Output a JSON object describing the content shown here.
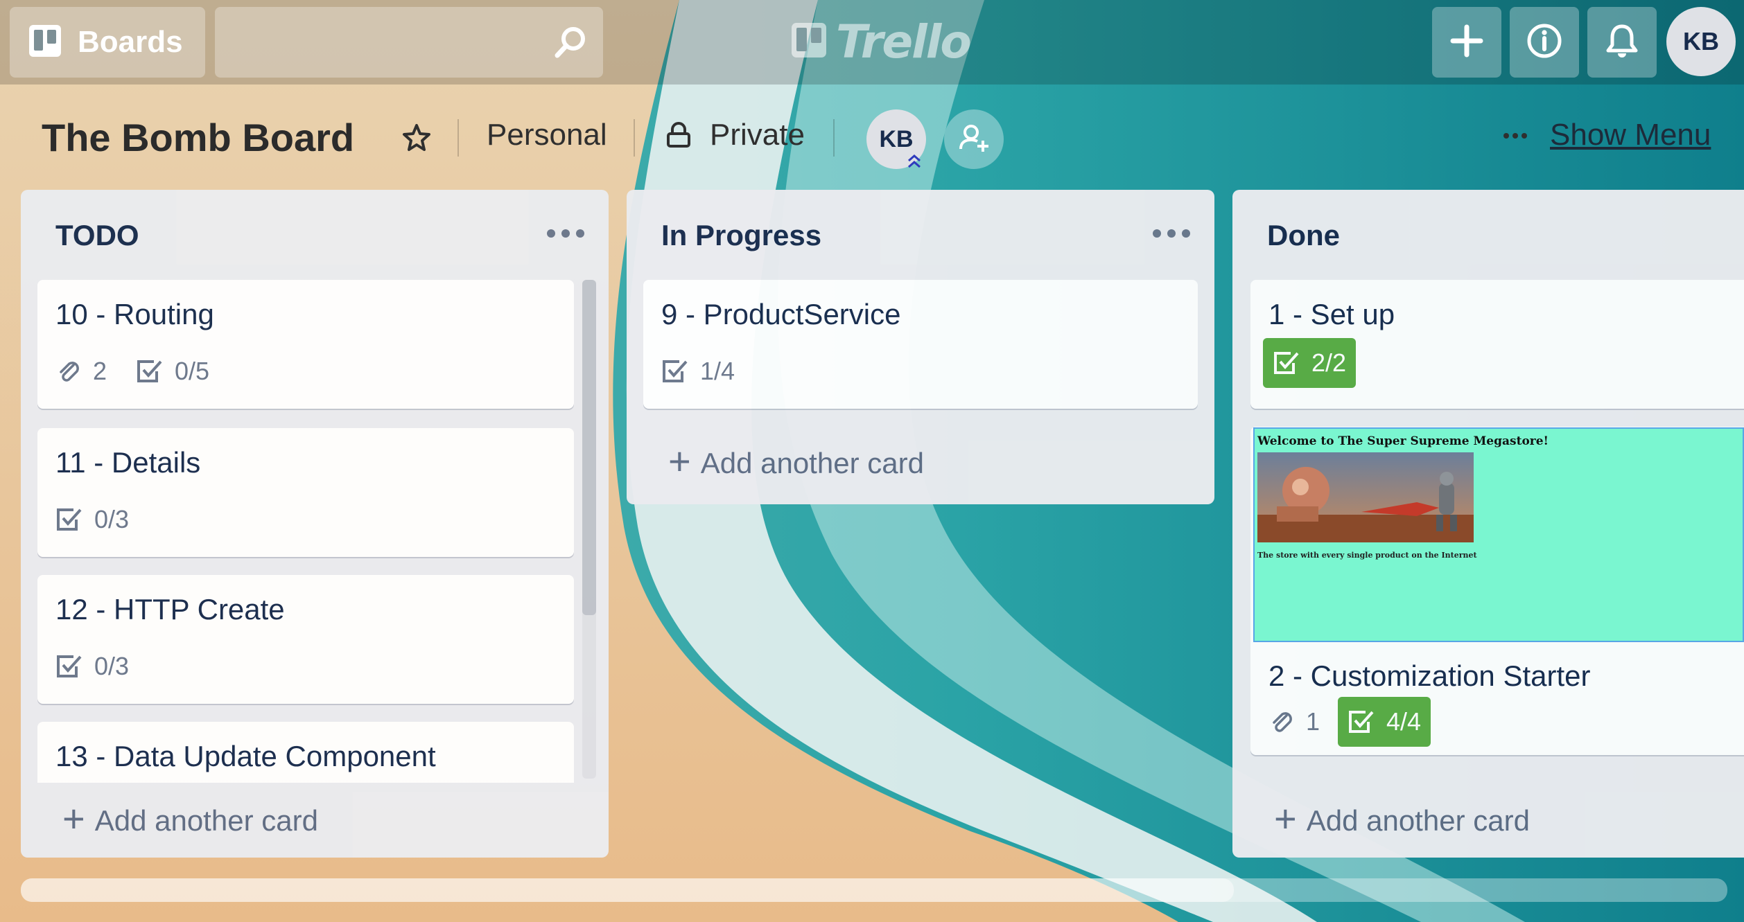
{
  "header": {
    "boards_label": "Boards",
    "search_placeholder": "",
    "logo_text": "Trello",
    "user_initials": "KB"
  },
  "board": {
    "title": "The Bomb Board",
    "team": "Personal",
    "visibility": "Private",
    "member_initials": "KB",
    "show_menu_label": "Show Menu"
  },
  "lists": [
    {
      "title": "TODO",
      "cards": [
        {
          "title": "10 - Routing",
          "attachments": "2",
          "checklist": "0/5"
        },
        {
          "title": "11 - Details",
          "checklist": "0/3"
        },
        {
          "title": "12 - HTTP Create",
          "checklist": "0/3"
        },
        {
          "title": "13 - Data Update Component"
        }
      ],
      "add_card_label": "Add another card"
    },
    {
      "title": "In Progress",
      "cards": [
        {
          "title": "9 - ProductService",
          "checklist": "1/4"
        }
      ],
      "add_card_label": "Add another card"
    },
    {
      "title": "Done",
      "cards": [
        {
          "title": "1 - Set up",
          "checklist": "2/2",
          "checklist_complete": true
        },
        {
          "title": "2 - Customization Starter",
          "attachments": "1",
          "checklist": "4/4",
          "checklist_complete": true,
          "cover": {
            "heading": "Welcome to The Super Supreme Megastore!",
            "subtext": "The store with every single product on the Internet",
            "background": "#7af6d0"
          }
        }
      ],
      "add_card_label": "Add another card"
    }
  ],
  "colors": {
    "complete_badge": "#5aac44",
    "list_bg": "#ebecf0",
    "text_primary": "#172b4d"
  }
}
